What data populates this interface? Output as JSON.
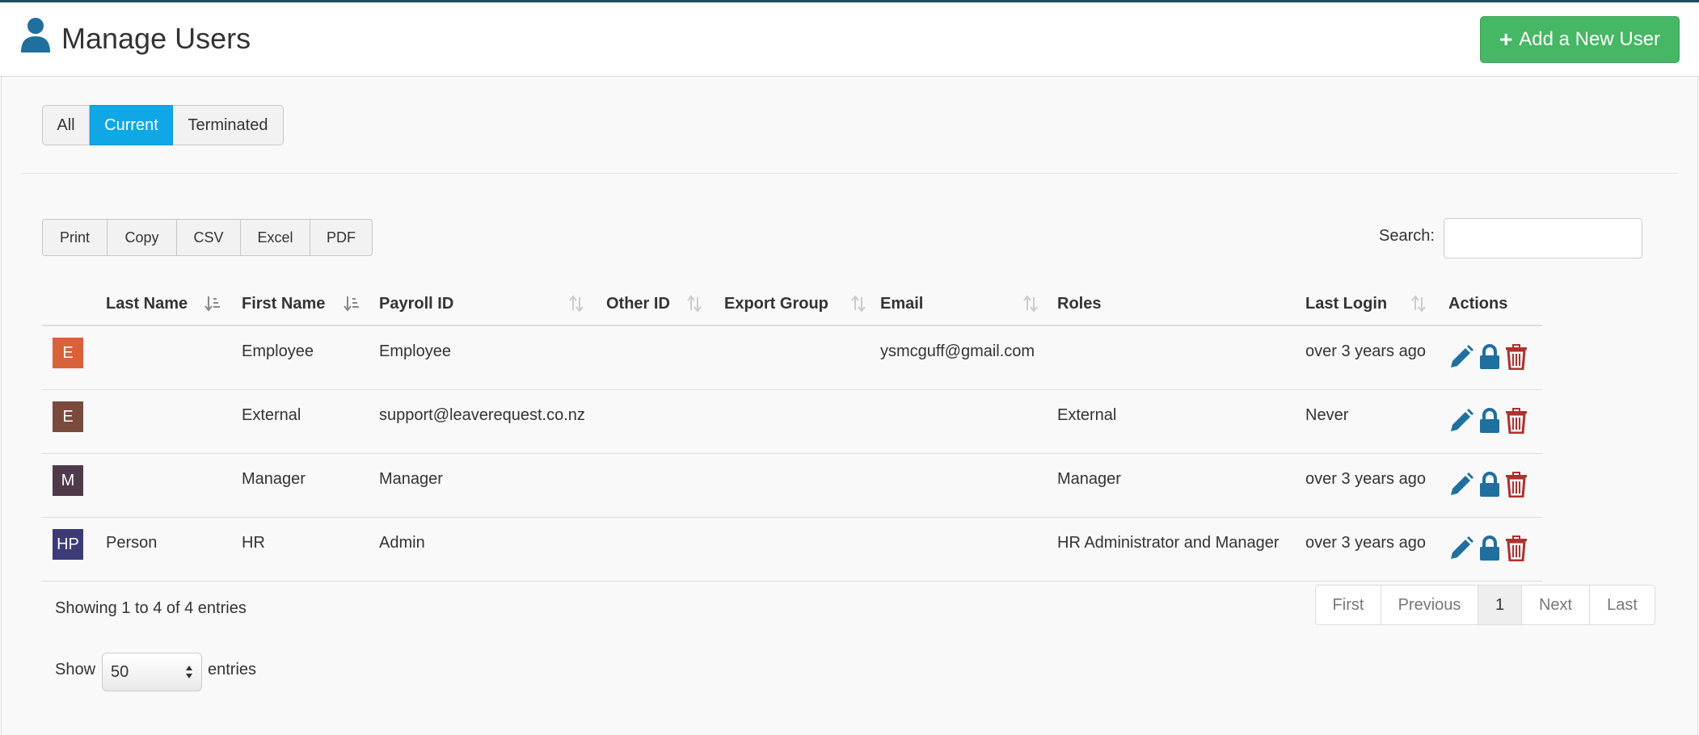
{
  "header": {
    "title": "Manage Users",
    "add_button_label": "Add a New User"
  },
  "filters": {
    "items": [
      {
        "label": "All",
        "active": false
      },
      {
        "label": "Current",
        "active": true
      },
      {
        "label": "Terminated",
        "active": false
      }
    ]
  },
  "export": {
    "items": [
      "Print",
      "Copy",
      "CSV",
      "Excel",
      "PDF"
    ]
  },
  "search": {
    "label": "Search:",
    "value": ""
  },
  "table": {
    "columns": [
      "",
      "Last Name",
      "First Name",
      "Payroll ID",
      "Other ID",
      "Export Group",
      "Email",
      "Roles",
      "Last Login",
      "Actions"
    ],
    "rows": [
      {
        "initials": "E",
        "avatar_color": "#d9623b",
        "last_name": "",
        "first_name": "Employee",
        "payroll_id": "Employee",
        "other_id": "",
        "export_group": "",
        "email": "ysmcguff@gmail.com",
        "roles": "",
        "last_login": "over 3 years ago"
      },
      {
        "initials": "E",
        "avatar_color": "#7a4a3c",
        "last_name": "",
        "first_name": "External",
        "payroll_id": "support@leaverequest.co.nz",
        "other_id": "",
        "export_group": "",
        "email": "",
        "roles": "External",
        "last_login": "Never"
      },
      {
        "initials": "M",
        "avatar_color": "#4f3a4c",
        "last_name": "",
        "first_name": "Manager",
        "payroll_id": "Manager",
        "other_id": "",
        "export_group": "",
        "email": "",
        "roles": "Manager",
        "last_login": "over 3 years ago"
      },
      {
        "initials": "HP",
        "avatar_color": "#3d3a78",
        "last_name": "Person",
        "first_name": "HR",
        "payroll_id": "Admin",
        "other_id": "",
        "export_group": "",
        "email": "",
        "roles": "HR Administrator and Manager",
        "last_login": "over 3 years ago"
      }
    ]
  },
  "footer": {
    "info": "Showing 1 to 4 of 4 entries",
    "show_label": "Show",
    "entries_value": "50",
    "entries_label": "entries"
  },
  "pagination": [
    "First",
    "Previous",
    "1",
    "Next",
    "Last"
  ],
  "colors": {
    "primary": "#10a7e6",
    "success": "#46b765",
    "action_blue": "#1f6f9f",
    "delete_red": "#b03030"
  }
}
